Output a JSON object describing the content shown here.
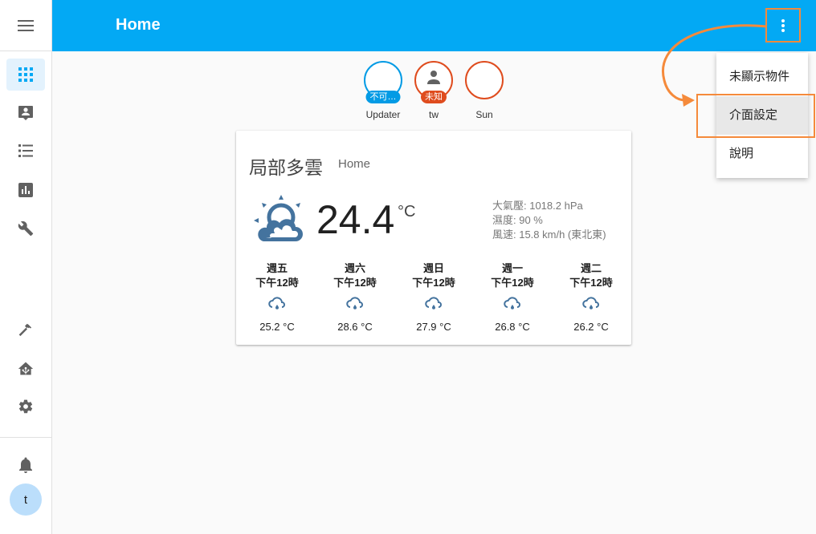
{
  "header": {
    "title": "Home"
  },
  "badges": [
    {
      "tag": "不可…",
      "label": "Updater",
      "tag_color": "#039be5"
    },
    {
      "tag": "未知",
      "label": "tw",
      "tag_color": "#df4c1e"
    },
    {
      "label": "Sun"
    }
  ],
  "weather": {
    "condition": "局部多雲",
    "name": "Home",
    "temperature": "24.4",
    "unit": "°C",
    "pressure": "大氣壓: 1018.2 hPa",
    "humidity": "濕度: 90 %",
    "wind": "風速: 15.8 km/h (東北東)",
    "forecast": [
      {
        "day": "週五",
        "time": "下午12時",
        "temp": "25.2 °C"
      },
      {
        "day": "週六",
        "time": "下午12時",
        "temp": "28.6 °C"
      },
      {
        "day": "週日",
        "time": "下午12時",
        "temp": "27.9 °C"
      },
      {
        "day": "週一",
        "time": "下午12時",
        "temp": "26.8 °C"
      },
      {
        "day": "週二",
        "time": "下午12時",
        "temp": "26.2 °C"
      }
    ]
  },
  "menu": {
    "items": [
      "未顯示物件",
      "介面設定",
      "說明"
    ]
  },
  "user": {
    "initial": "t"
  },
  "colors": {
    "primary": "#03a9f4",
    "accent_highlight": "#f58a3b",
    "icon_grey": "#616161",
    "weather_blue": "#44739e"
  }
}
